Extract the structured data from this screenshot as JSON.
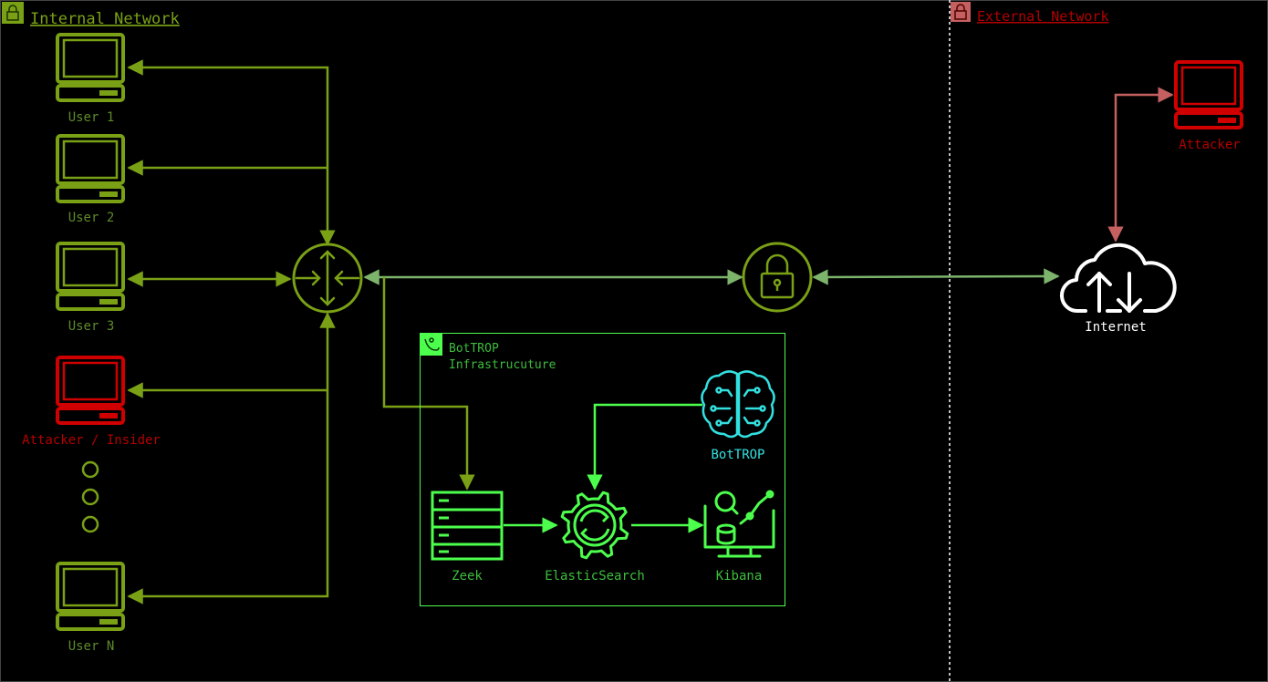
{
  "colors": {
    "green": "#7aa116",
    "green_text": "#5e8a2a",
    "red": "#d10000",
    "red_text": "#b30000",
    "bright_green": "#4dff4d",
    "infra_text": "#3dbd3d",
    "cyan": "#33e0e0",
    "link_gray": "#7db46c",
    "link_red": "#c46060",
    "white": "#ffffff"
  },
  "internal": {
    "title": "Internal Network"
  },
  "external": {
    "title": "External Network"
  },
  "users": [
    {
      "label": "User 1",
      "type": "user"
    },
    {
      "label": "User 2",
      "type": "user"
    },
    {
      "label": "User 3",
      "type": "user"
    },
    {
      "label": "Attacker / Insider",
      "type": "attacker"
    },
    {
      "label": "User N",
      "type": "user"
    }
  ],
  "router": {
    "icon": "router-icon"
  },
  "firewall": {
    "icon": "lock-icon"
  },
  "internet": {
    "label": "Internet",
    "icon": "cloud-icon"
  },
  "external_attacker": {
    "label": "Attacker"
  },
  "infra": {
    "title_line1": "BotTROP",
    "title_line2": "Infrastrucuture",
    "zeek": "Zeek",
    "elastic": "ElasticSearch",
    "kibana": "Kibana",
    "bottrop": "BotTROP"
  }
}
